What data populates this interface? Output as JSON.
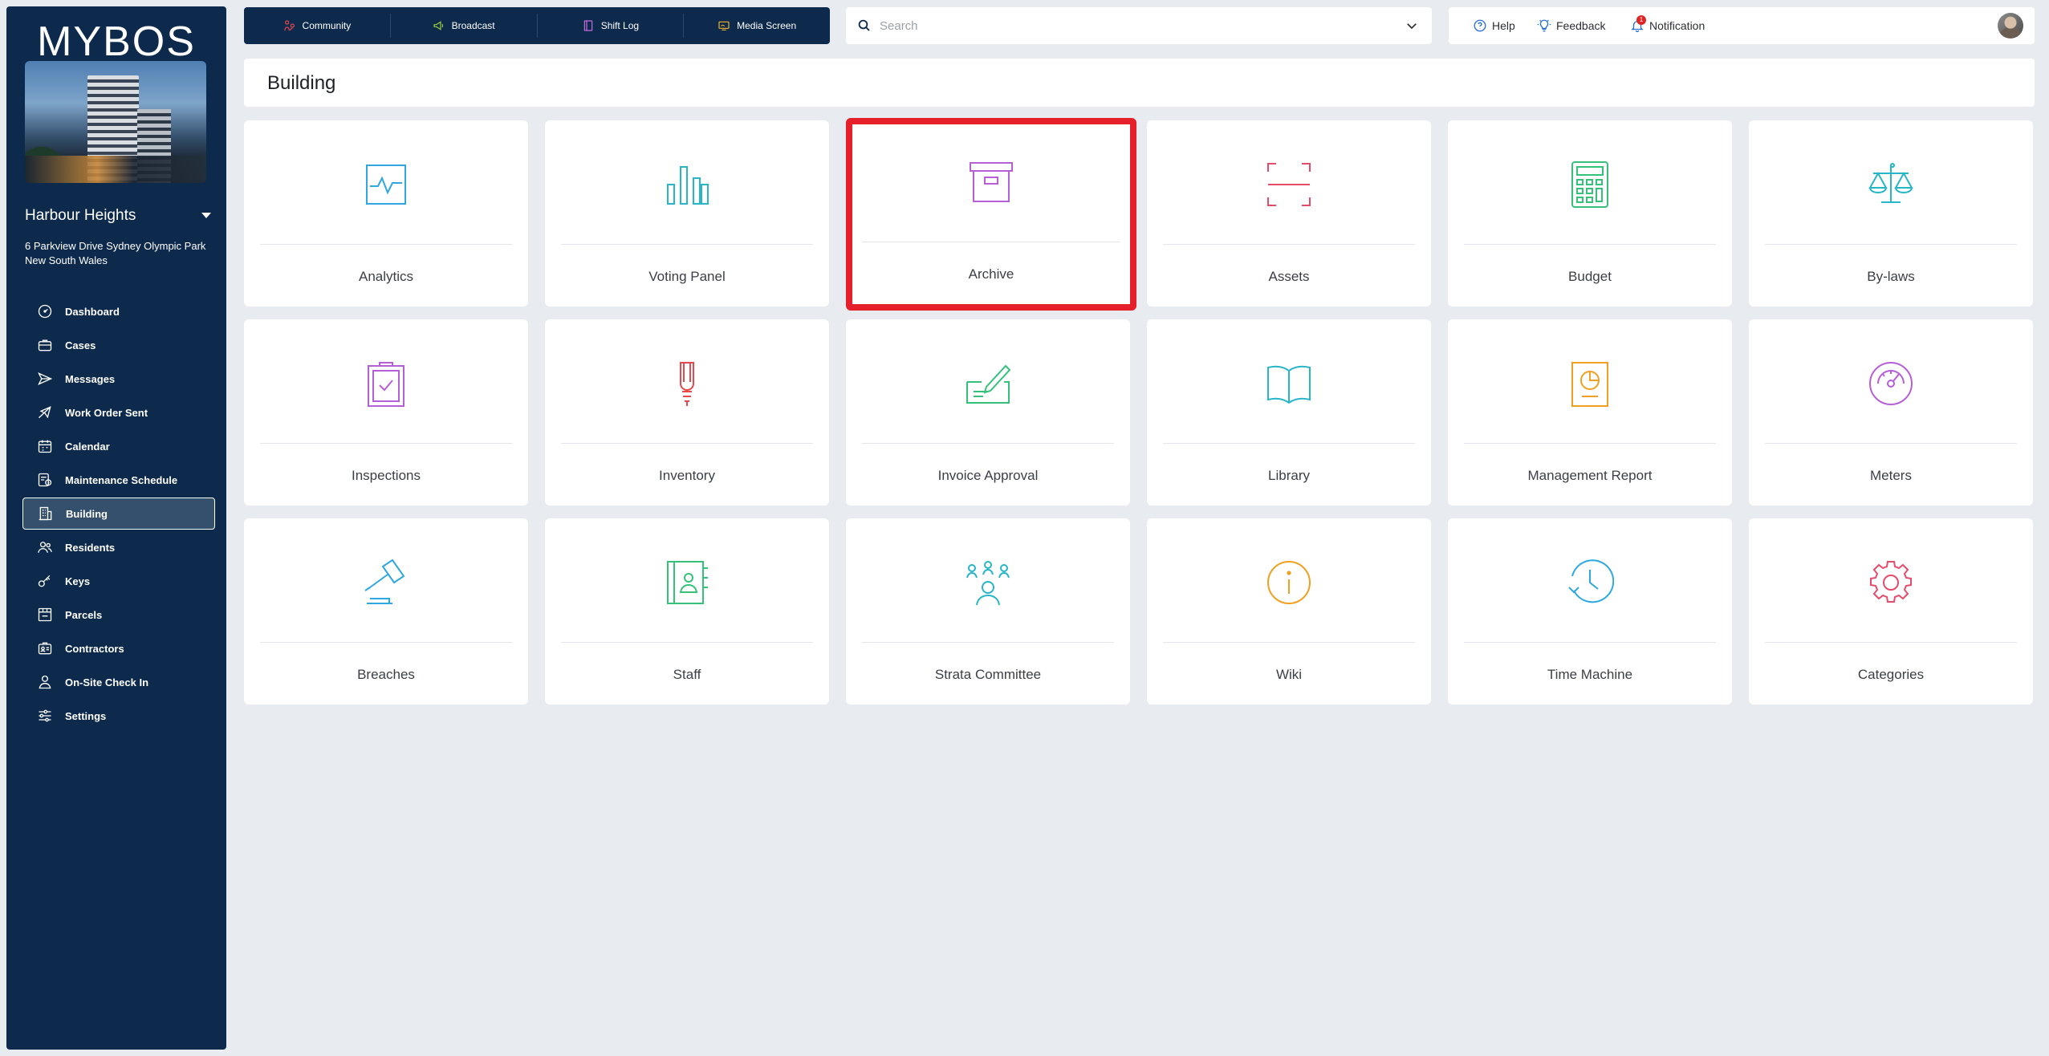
{
  "sidebar": {
    "logo": "MYBOS",
    "site_name": "Harbour Heights",
    "site_address": "6 Parkview Drive Sydney Olympic Park New South Wales",
    "items": [
      {
        "label": "Dashboard",
        "icon": "dashboard-icon"
      },
      {
        "label": "Cases",
        "icon": "briefcase-icon"
      },
      {
        "label": "Messages",
        "icon": "send-icon"
      },
      {
        "label": "Work Order Sent",
        "icon": "megaphone-icon"
      },
      {
        "label": "Calendar",
        "icon": "calendar-icon"
      },
      {
        "label": "Maintenance Schedule",
        "icon": "schedule-icon"
      },
      {
        "label": "Building",
        "icon": "building-icon",
        "active": true
      },
      {
        "label": "Residents",
        "icon": "residents-icon"
      },
      {
        "label": "Keys",
        "icon": "key-icon"
      },
      {
        "label": "Parcels",
        "icon": "parcel-icon"
      },
      {
        "label": "Contractors",
        "icon": "contractor-icon"
      },
      {
        "label": "On-Site Check In",
        "icon": "check-in-icon"
      },
      {
        "label": "Settings",
        "icon": "settings-icon"
      }
    ]
  },
  "quickbar": {
    "items": [
      {
        "label": "Community",
        "icon": "community-icon",
        "color": "#e5484d"
      },
      {
        "label": "Broadcast",
        "icon": "broadcast-icon",
        "color": "#9ccc3c"
      },
      {
        "label": "Shift Log",
        "icon": "shift-log-icon",
        "color": "#c86be0"
      },
      {
        "label": "Media Screen",
        "icon": "media-screen-icon",
        "color": "#f0b429"
      }
    ]
  },
  "search": {
    "placeholder": "Search"
  },
  "userbar": {
    "help": "Help",
    "feedback": "Feedback",
    "notification": "Notification",
    "notification_count": "1"
  },
  "page": {
    "title": "Building"
  },
  "tiles": [
    {
      "label": "Analytics",
      "icon": "analytics-icon",
      "color": "#2ea8e0"
    },
    {
      "label": "Voting Panel",
      "icon": "bar-chart-icon",
      "color": "#27b5c8"
    },
    {
      "label": "Archive",
      "icon": "archive-box-icon",
      "color": "#b65fd6",
      "selected": true
    },
    {
      "label": "Assets",
      "icon": "scan-frame-icon",
      "color": "#e54b6b"
    },
    {
      "label": "Budget",
      "icon": "calculator-icon",
      "color": "#34c27a"
    },
    {
      "label": "By-laws",
      "icon": "scales-icon",
      "color": "#27b5c8"
    },
    {
      "label": "Inspections",
      "icon": "clipboard-check-icon",
      "color": "#b65fd6"
    },
    {
      "label": "Inventory",
      "icon": "lightbulb-icon",
      "color": "#e5484d"
    },
    {
      "label": "Invoice Approval",
      "icon": "signature-icon",
      "color": "#34c27a"
    },
    {
      "label": "Library",
      "icon": "book-icon",
      "color": "#27b5c8"
    },
    {
      "label": "Management Report",
      "icon": "report-icon",
      "color": "#f0a020"
    },
    {
      "label": "Meters",
      "icon": "gauge-icon",
      "color": "#b65fd6"
    },
    {
      "label": "Breaches",
      "icon": "gavel-icon",
      "color": "#2ea8e0"
    },
    {
      "label": "Staff",
      "icon": "staff-book-icon",
      "color": "#34c27a"
    },
    {
      "label": "Strata Committee",
      "icon": "committee-icon",
      "color": "#27b5c8"
    },
    {
      "label": "Wiki",
      "icon": "info-icon",
      "color": "#f0a020"
    },
    {
      "label": "Time Machine",
      "icon": "history-icon",
      "color": "#2ea8e0"
    },
    {
      "label": "Categories",
      "icon": "gear-network-icon",
      "color": "#e54b6b"
    }
  ]
}
